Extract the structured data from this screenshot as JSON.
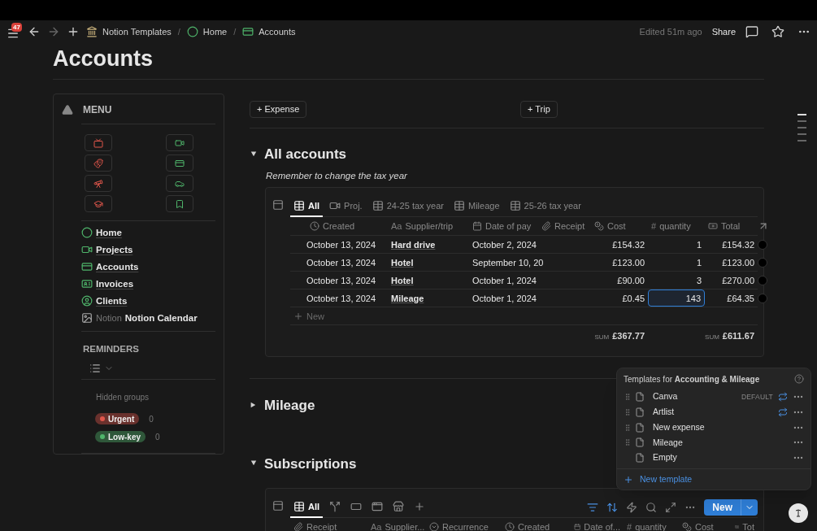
{
  "topbar": {
    "notification_count": "47",
    "breadcrumb_separator": "/",
    "breadcrumbs": [
      {
        "kind": "workspace",
        "label": "Notion Templates"
      },
      {
        "kind": "home",
        "label": "Home"
      },
      {
        "kind": "accounts",
        "label": "Accounts"
      }
    ],
    "edited": "Edited 51m ago",
    "share": "Share"
  },
  "title": "Accounts",
  "menu": {
    "title": "MENU",
    "links": [
      {
        "kind": "home",
        "label": "Home"
      },
      {
        "kind": "projects",
        "label": "Projects"
      },
      {
        "kind": "accounts",
        "label": "Accounts"
      },
      {
        "kind": "invoices",
        "label": "Invoices"
      },
      {
        "kind": "clients",
        "label": "Clients"
      },
      {
        "kind": "calendar",
        "prefix": "Notion",
        "label": "Notion Calendar"
      }
    ],
    "reminders": {
      "title": "REMINDERS",
      "hidden_groups": "Hidden groups",
      "groups": [
        {
          "label": "Urgent",
          "count": "0",
          "color": "#e0564b"
        },
        {
          "label": "Low-key",
          "count": "0",
          "color": "#4fb56b"
        }
      ]
    }
  },
  "buttons": [
    "+ Expense",
    "+ Trip"
  ],
  "sections": [
    {
      "title": "All accounts",
      "expanded": true,
      "note": "Remember to change the tax year",
      "database": {
        "kind": "table",
        "views": [
          {
            "kind": "table",
            "label": "All",
            "selected": true
          },
          {
            "kind": "camera",
            "label": "Proj.",
            "selected": false
          },
          {
            "kind": "table",
            "label": "24-25 tax year",
            "selected": false
          },
          {
            "kind": "table",
            "label": "Mileage",
            "selected": false
          },
          {
            "kind": "table",
            "label": "25-26 tax year",
            "selected": false
          }
        ],
        "columns": [
          {
            "kind": "created",
            "label": "Created"
          },
          {
            "kind": "title",
            "glyph": "Aa",
            "label": "Supplier/trip"
          },
          {
            "kind": "date",
            "label": "Date of pay"
          },
          {
            "kind": "files",
            "label": "Receipt"
          },
          {
            "kind": "money",
            "label": "Cost"
          },
          {
            "kind": "number",
            "glyph": "#",
            "label": "quantity"
          },
          {
            "kind": "formula",
            "label": "Total"
          }
        ],
        "rows": [
          {
            "cells": [
              "October 13, 2024",
              "Hard drive",
              "October 2, 2024",
              "",
              "£154.32",
              "1",
              "£154.32"
            ],
            "quantity_focused": false
          },
          {
            "cells": [
              "October 13, 2024",
              "Hotel",
              "September 10, 20",
              "",
              "£123.00",
              "1",
              "£123.00"
            ],
            "quantity_focused": false
          },
          {
            "cells": [
              "October 13, 2024",
              "Hotel",
              "October 1, 2024",
              "",
              "£90.00",
              "3",
              "£270.00"
            ],
            "quantity_focused": false
          },
          {
            "cells": [
              "October 13, 2024",
              "Mileage",
              "October 1, 2024",
              "",
              "£0.45",
              "143",
              "£64.35"
            ],
            "quantity_focused": true
          }
        ],
        "new_row": "New",
        "sums": [
          {
            "label": "SUM",
            "value": "£367.77"
          },
          {
            "label": "SUM",
            "value": "£611.67"
          }
        ]
      }
    },
    {
      "title": "Mileage",
      "expanded": false
    },
    {
      "title": "Subscriptions",
      "expanded": true,
      "database": {
        "kind": "table",
        "views": [
          {
            "kind": "table",
            "label": "All",
            "selected": true
          },
          {
            "kind": "fork",
            "selected": false
          },
          {
            "kind": "card",
            "selected": false
          },
          {
            "kind": "window",
            "selected": false
          },
          {
            "kind": "store",
            "selected": false
          },
          {
            "kind": "add",
            "selected": false
          }
        ],
        "new_button": "New",
        "columns": [
          {
            "kind": "files",
            "label": "Receipt"
          },
          {
            "kind": "title",
            "glyph": "Aa",
            "label": "Supplier..."
          },
          {
            "kind": "select",
            "label": "Recurrence"
          },
          {
            "kind": "created",
            "label": "Created"
          },
          {
            "kind": "date",
            "label": "Date of..."
          },
          {
            "kind": "number",
            "glyph": "#",
            "label": "quantity"
          },
          {
            "kind": "money",
            "label": "Cost"
          },
          {
            "kind": "formula",
            "label": "Tot"
          }
        ]
      }
    }
  ],
  "templates": {
    "title": "Templates for **Accounting & Mileage**",
    "items": [
      {
        "label": "Canva",
        "badge": "DEFAULT",
        "repeat": true,
        "draggable": true
      },
      {
        "label": "Artlist",
        "repeat": true,
        "draggable": true
      },
      {
        "label": "New expense",
        "repeat": false,
        "draggable": true
      },
      {
        "label": "Mileage",
        "repeat": false,
        "draggable": true
      },
      {
        "label": "Empty",
        "repeat": false,
        "draggable": false
      }
    ],
    "new_template": "New template"
  }
}
